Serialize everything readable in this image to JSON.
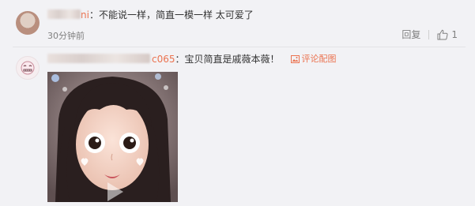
{
  "comments": [
    {
      "username_visible": "ni",
      "text": "不能说一样，简直一模一样 太可爱了",
      "time": "30分钟前",
      "reply_label": "回复",
      "like_count": "1"
    },
    {
      "username_visible": "c065",
      "text": "宝贝简直是戚薇本薇！",
      "pic_link_label": "评论配图"
    }
  ],
  "icons": {
    "like": "thumbs-up-icon",
    "picture": "image-icon",
    "play": "play-icon"
  },
  "colors": {
    "username": "#eb7350",
    "background": "#f2f2f5",
    "muted": "#808080"
  }
}
